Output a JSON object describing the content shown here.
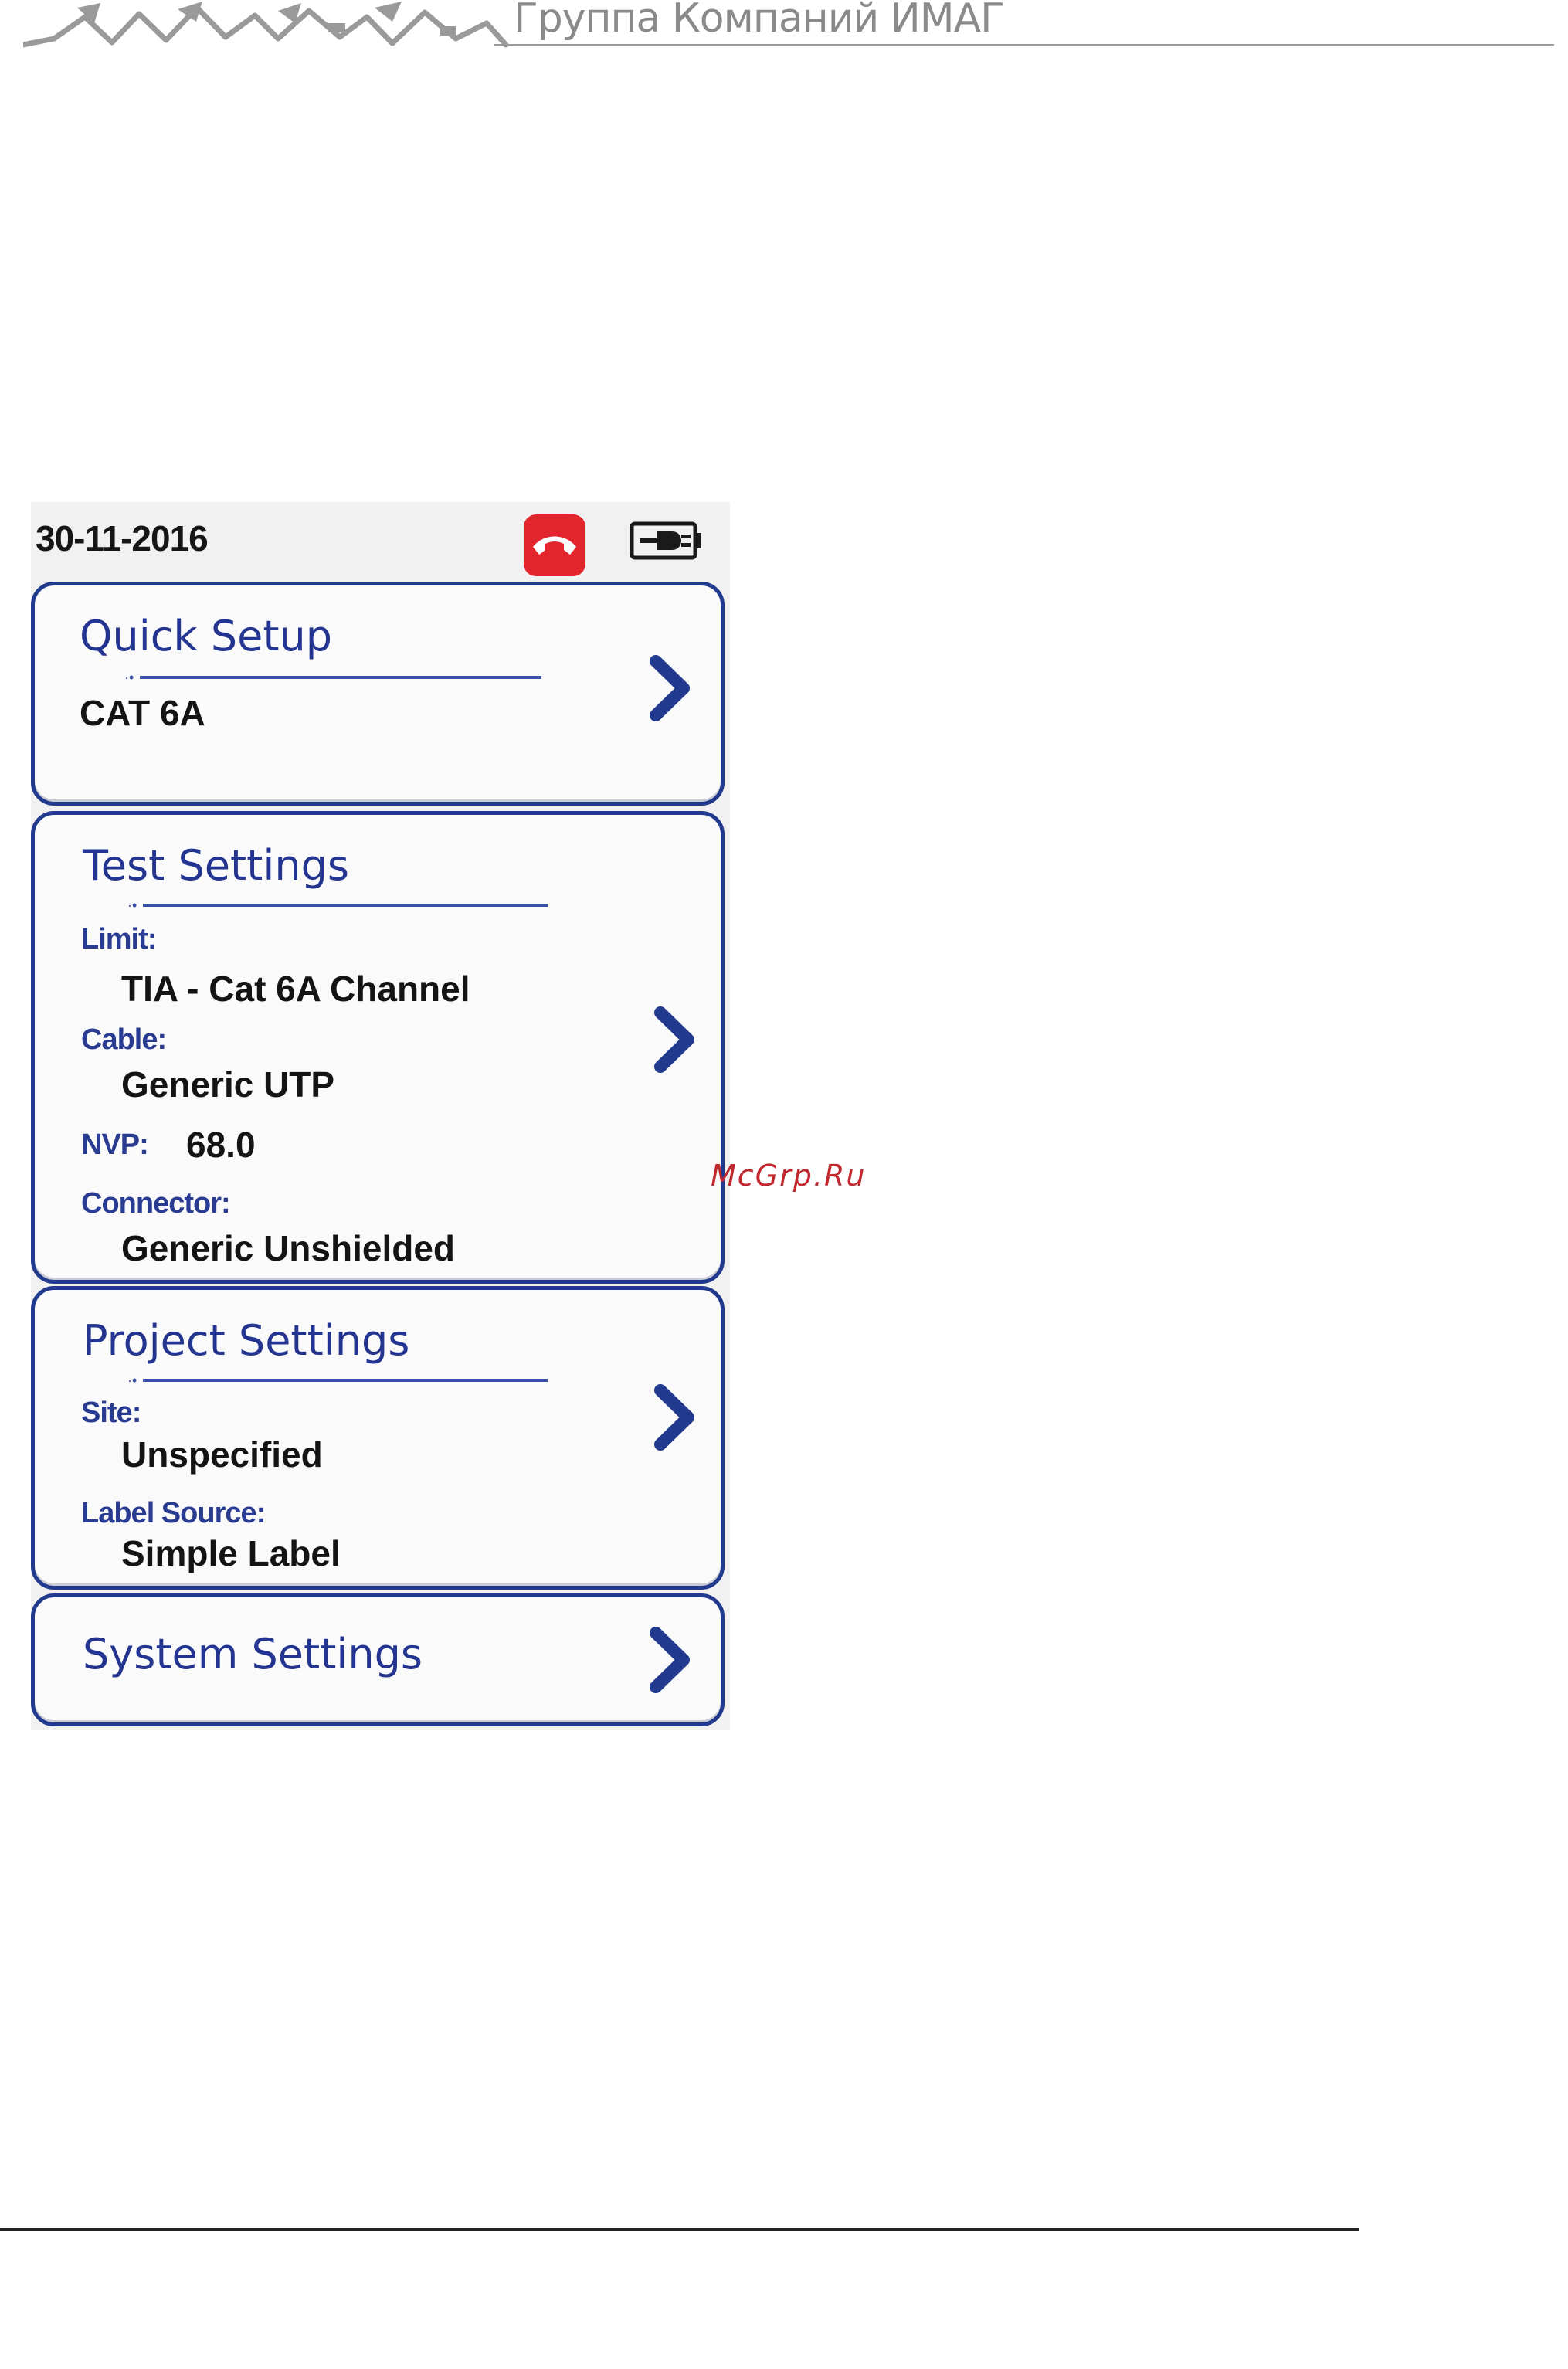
{
  "brand": {
    "name": "Группа Компаний ИМАГ"
  },
  "watermark": {
    "text": "McGrp.Ru"
  },
  "status_bar": {
    "date": "30-11-2016",
    "icons": {
      "call": "phone-hangup-icon",
      "power": "battery-plug-icon"
    },
    "colors": {
      "call_bg": "#e3262d"
    }
  },
  "quick_setup": {
    "title": "Quick Setup",
    "value": "CAT 6A"
  },
  "test_settings": {
    "title": "Test Settings",
    "limit_label": "Limit:",
    "limit_value": "TIA - Cat 6A Channel",
    "cable_label": "Cable:",
    "cable_value": "Generic UTP",
    "nvp_label": "NVP:",
    "nvp_value": "68.0",
    "connector_label": "Connector:",
    "connector_value": "Generic Unshielded"
  },
  "project_settings": {
    "title": "Project Settings",
    "site_label": "Site:",
    "site_value": "Unspecified",
    "label_source_label": "Label Source:",
    "label_source_value": "Simple Label"
  },
  "system_settings": {
    "title": "System Settings"
  },
  "theme": {
    "accent": "#223a8e",
    "label_blue": "#2a3b92"
  }
}
